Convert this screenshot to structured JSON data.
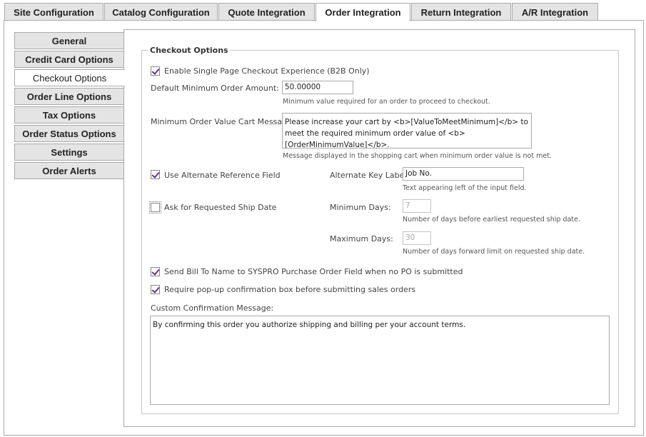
{
  "top_tabs": [
    {
      "label": "Site Configuration"
    },
    {
      "label": "Catalog Configuration"
    },
    {
      "label": "Quote Integration"
    },
    {
      "label": "Order Integration"
    },
    {
      "label": "Return Integration"
    },
    {
      "label": "A/R Integration"
    }
  ],
  "side_tabs": [
    {
      "label": "General"
    },
    {
      "label": "Credit Card Options"
    },
    {
      "label": "Checkout Options"
    },
    {
      "label": "Order Line Options"
    },
    {
      "label": "Tax Options"
    },
    {
      "label": "Order Status Options"
    },
    {
      "label": "Settings"
    },
    {
      "label": "Order Alerts"
    }
  ],
  "checkout": {
    "legend": "Checkout Options",
    "single_page": {
      "label": "Enable Single Page Checkout Experience (B2B Only)",
      "checked": true
    },
    "min_order": {
      "label": "Default Minimum Order Amount:",
      "value": "50.00000",
      "hint": "Minimum value required for an order to proceed to checkout."
    },
    "cart_message": {
      "label": "Minimum Order Value Cart Message:",
      "value": "Please increase your cart by <b>[ValueToMeetMinimum]</b> to meet the required minimum order value of <b>[OrderMinimumValue]</b>.",
      "hint": "Message displayed in the shopping cart when minimum order value is not met."
    },
    "alt_ref": {
      "label": "Use Alternate Reference Field",
      "checked": true
    },
    "alt_key": {
      "label": "Alternate Key Label:",
      "value": "Job No.",
      "hint": "Text appearing left of the input field."
    },
    "ship_date": {
      "label": "Ask for Requested Ship Date",
      "checked": false
    },
    "min_days": {
      "label": "Minimum Days:",
      "value": "7",
      "hint": "Number of days before earliest requested ship date."
    },
    "max_days": {
      "label": "Maximum Days:",
      "value": "30",
      "hint": "Number of days forward limit on requested ship date."
    },
    "bill_to": {
      "label": "Send Bill To Name to SYSPRO Purchase Order Field when no PO is submitted",
      "checked": true
    },
    "popup": {
      "label": "Require pop-up confirmation box before submitting sales orders",
      "checked": true
    },
    "confirm": {
      "label": "Custom Confirmation Message:",
      "value": "By confirming this order you authorize shipping and billing per your account terms."
    }
  },
  "colors": {
    "checkmark": "#5b3a87",
    "tab_bg": "#e4e4e4",
    "border": "#a9a9a9"
  }
}
